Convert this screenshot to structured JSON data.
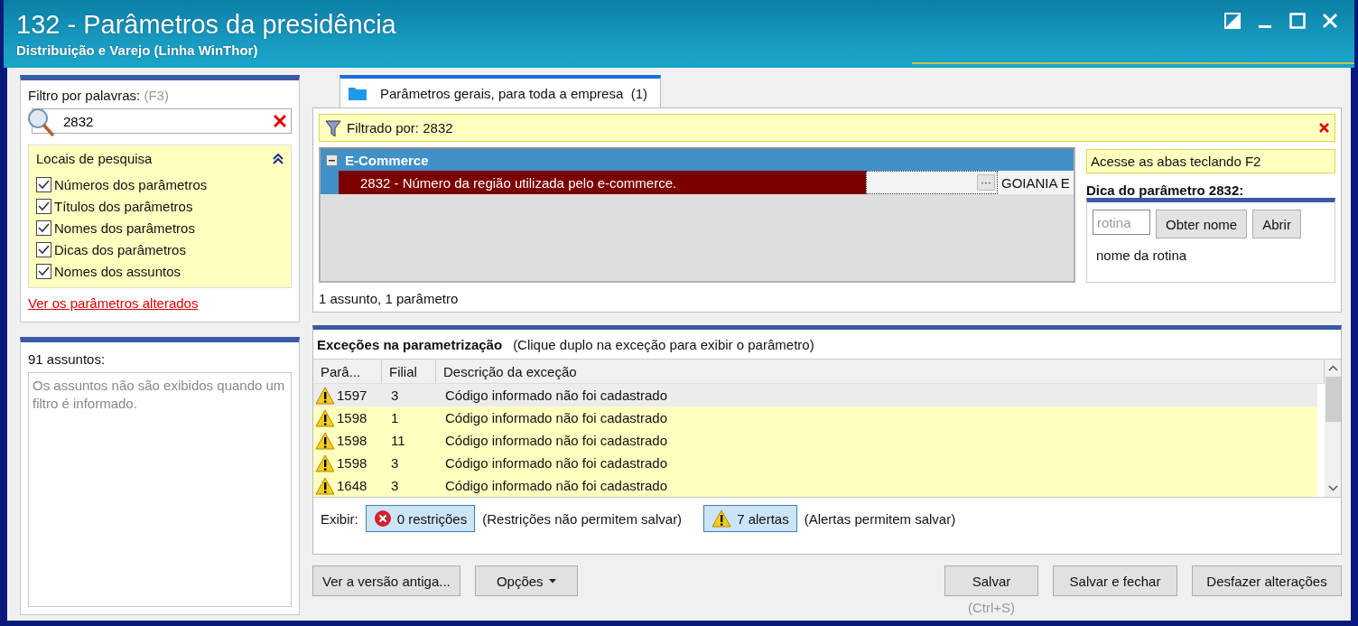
{
  "window": {
    "title": "132 - Parâmetros da presidência",
    "subtitle": "Distribuição e Varejo (Linha WinThor)"
  },
  "filter": {
    "label": "Filtro por palavras:",
    "shortcut": "(F3)",
    "value": "2832"
  },
  "search_locations": {
    "title": "Locais de pesquisa",
    "expanded": true,
    "options": [
      {
        "label": "Números dos parâmetros",
        "checked": true
      },
      {
        "label": "Títulos dos parâmetros",
        "checked": true
      },
      {
        "label": "Nomes dos parâmetros",
        "checked": true
      },
      {
        "label": "Dicas dos parâmetros",
        "checked": true
      },
      {
        "label": "Nomes dos assuntos",
        "checked": true
      }
    ]
  },
  "changed_link": "Ver os parâmetros alterados",
  "subjects": {
    "count_label": "91 assuntos:",
    "message": "Os assuntos não são exibidos quando um filtro é informado."
  },
  "tabs": [
    {
      "label": "Parâmetros gerais, para toda a empresa  (1)",
      "selected": true
    }
  ],
  "filter_bar": {
    "text": "Filtrado por: 2832"
  },
  "tree": [
    {
      "name": "E-Commerce",
      "expanded": true,
      "children": [
        {
          "name": "2832 - Número da região utilizada pelo e-commerce.",
          "selected": true,
          "lookup_button": "···",
          "lookup": "GOIANIA E"
        }
      ]
    }
  ],
  "summary": "1 assunto, 1 parâmetro",
  "hint": {
    "shortcut_note": "Acesse as abas teclando F2",
    "title": "Dica do parâmetro 2832:",
    "routine_placeholder": "rotina",
    "buttons": [
      "Obter nome",
      "Abrir"
    ],
    "routine_name": "nome da rotina"
  },
  "exceptions": {
    "title": "Exceções na parametrização",
    "note": "(Clique duplo na exceção para exibir o parâmetro)",
    "columns": [
      "Parâ...",
      "Filial",
      "Descrição da exceção"
    ],
    "rows": [
      {
        "kind": "alert",
        "param": "1597",
        "branch": "3",
        "description": "Código informado não foi cadastrado",
        "selected": true
      },
      {
        "kind": "alert",
        "param": "1598",
        "branch": "1",
        "description": "Código informado não foi cadastrado",
        "selected": false
      },
      {
        "kind": "alert",
        "param": "1598",
        "branch": "11",
        "description": "Código informado não foi cadastrado",
        "selected": false
      },
      {
        "kind": "alert",
        "param": "1598",
        "branch": "3",
        "description": "Código informado não foi cadastrado",
        "selected": false
      },
      {
        "kind": "alert",
        "param": "1648",
        "branch": "3",
        "description": "Código informado não foi cadastrado",
        "selected": false
      }
    ]
  },
  "display": {
    "label": "Exibir:",
    "filters": [
      {
        "kind": "restriction",
        "label": "0 restrições",
        "note": "(Restrições não permitem salvar)",
        "selected": true
      },
      {
        "kind": "alert",
        "label": "7 alertas",
        "note": "(Alertas permitem salvar)",
        "selected": true
      }
    ]
  },
  "buttons_left": [
    {
      "label": "Ver a versão antiga...",
      "dropdown": false
    },
    {
      "label": "Opções",
      "dropdown": true
    }
  ],
  "buttons_right": [
    {
      "label": "Salvar",
      "hint": "(Ctrl+S)"
    },
    {
      "label": "Salvar e fechar"
    },
    {
      "label": "Desfazer alterações"
    }
  ]
}
